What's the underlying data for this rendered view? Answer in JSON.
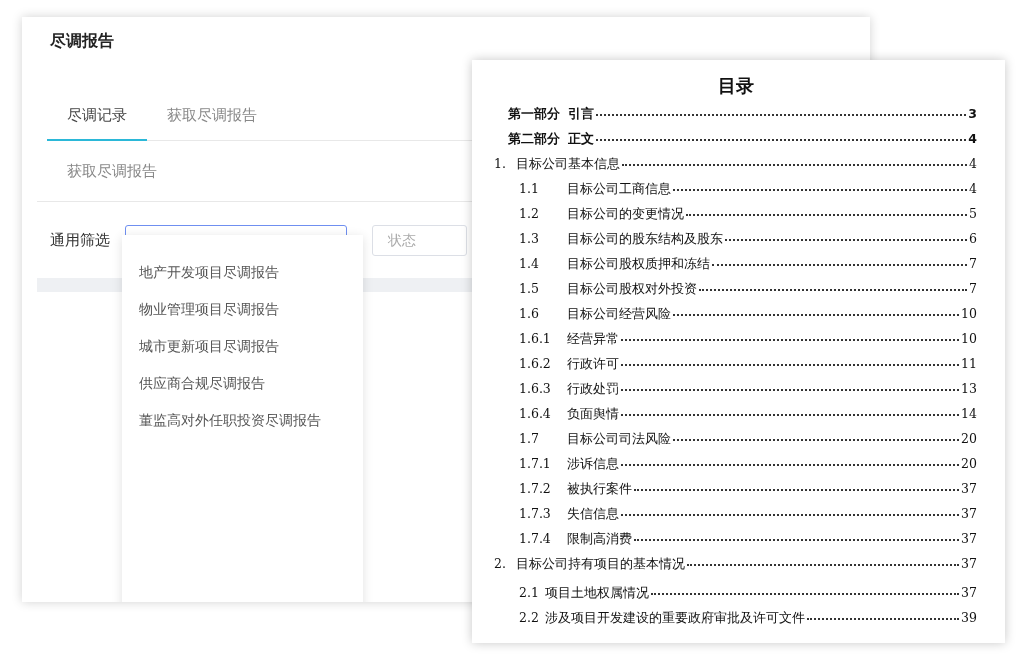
{
  "app": {
    "title": "尽调报告",
    "tabs": [
      {
        "label": "尽调记录",
        "selected": true
      },
      {
        "label": "获取尽调报告",
        "selected": false
      }
    ],
    "action": "获取尽调报告",
    "filter": {
      "label": "通用筛选",
      "status_placeholder": "状态"
    },
    "dropdown": [
      {
        "label": "地产开发项目尽调报告"
      },
      {
        "label": "物业管理项目尽调报告"
      },
      {
        "label": "城市更新项目尽调报告"
      },
      {
        "label": "供应商合规尽调报告"
      },
      {
        "label": "董监高对外任职投资尽调报告"
      }
    ]
  },
  "document": {
    "title": "目录",
    "entries": [
      {
        "kind": "part",
        "number": "第一部分",
        "title": "引言",
        "page": "3"
      },
      {
        "kind": "part",
        "number": "第二部分",
        "title": "正文",
        "page": "4"
      },
      {
        "kind": "chapter",
        "number": "1.",
        "title": "目标公司基本信息",
        "page": "4"
      },
      {
        "kind": "section",
        "number": "1.1",
        "title": "目标公司工商信息",
        "page": "4"
      },
      {
        "kind": "section",
        "number": "1.2",
        "title": "目标公司的变更情况",
        "page": "5"
      },
      {
        "kind": "section",
        "number": "1.3",
        "title": "目标公司的股东结构及股东",
        "page": "6"
      },
      {
        "kind": "section",
        "number": "1.4",
        "title": "目标公司股权质押和冻结",
        "page": "7"
      },
      {
        "kind": "section",
        "number": "1.5",
        "title": "目标公司股权对外投资",
        "page": "7"
      },
      {
        "kind": "section",
        "number": "1.6",
        "title": "目标公司经营风险",
        "page": "10"
      },
      {
        "kind": "section",
        "number": "1.6.1",
        "title": "经营异常",
        "page": "10"
      },
      {
        "kind": "section",
        "number": "1.6.2",
        "title": "行政许可",
        "page": "11"
      },
      {
        "kind": "section",
        "number": "1.6.3",
        "title": "行政处罚",
        "page": "13"
      },
      {
        "kind": "section",
        "number": "1.6.4",
        "title": "负面舆情",
        "page": "14"
      },
      {
        "kind": "section",
        "number": "1.7",
        "title": "目标公司司法风险",
        "page": "20"
      },
      {
        "kind": "section",
        "number": "1.7.1",
        "title": "涉诉信息",
        "page": "20"
      },
      {
        "kind": "section",
        "number": "1.7.2",
        "title": "被执行案件",
        "page": "37"
      },
      {
        "kind": "section",
        "number": "1.7.3",
        "title": "失信信息",
        "page": "37"
      },
      {
        "kind": "section",
        "number": "1.7.4",
        "title": "限制高消费",
        "page": "37"
      },
      {
        "kind": "chapter",
        "number": "2.",
        "title": "目标公司持有项目的基本情况",
        "page": "37"
      },
      {
        "kind": "item",
        "number": "2.1",
        "title": "项目土地权属情况",
        "page": "37"
      },
      {
        "kind": "item",
        "number": "2.2",
        "title": "涉及项目开发建设的重要政府审批及许可文件",
        "page": "39"
      }
    ]
  }
}
